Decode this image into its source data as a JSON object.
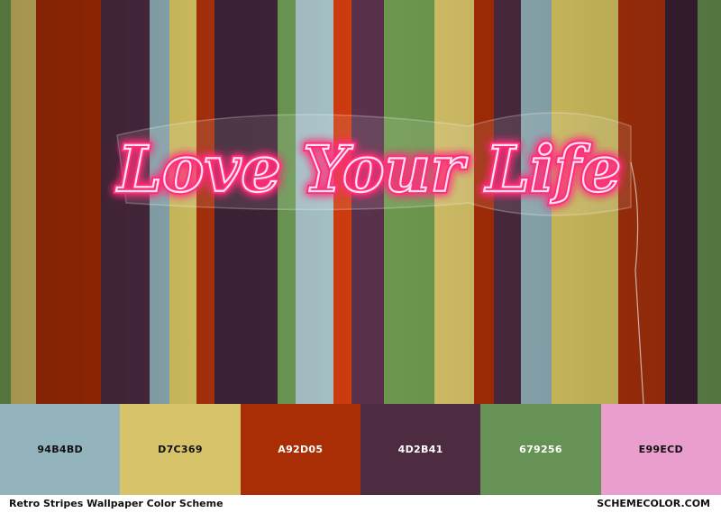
{
  "photo": {
    "sign_text": "Love Your Life",
    "stripe_colors": [
      "#6f9a4f",
      "#d7c369",
      "#a92d05",
      "#4d2b41",
      "#94b4bd",
      "#e2cf67",
      "#b4340c",
      "#3f2438",
      "#6e9a55",
      "#a7c2c8",
      "#cf3b0f",
      "#59314a"
    ],
    "neon_color": "#ff6fb0",
    "neon_glow": "#ff2d7a"
  },
  "palette": {
    "swatches": [
      {
        "hex": "94B4BD",
        "color": "#94B4BD",
        "text_color": "#111111"
      },
      {
        "hex": "D7C369",
        "color": "#D7C369",
        "text_color": "#111111"
      },
      {
        "hex": "A92D05",
        "color": "#A92D05",
        "text_color": "#ffffff"
      },
      {
        "hex": "4D2B41",
        "color": "#4D2B41",
        "text_color": "#ffffff"
      },
      {
        "hex": "679256",
        "color": "#679256",
        "text_color": "#ffffff"
      },
      {
        "hex": "E99ECD",
        "color": "#E99ECD",
        "text_color": "#111111"
      }
    ]
  },
  "footer": {
    "title": "Retro Stripes Wallpaper Color Scheme",
    "site": "SCHEMECOLOR.COM"
  }
}
